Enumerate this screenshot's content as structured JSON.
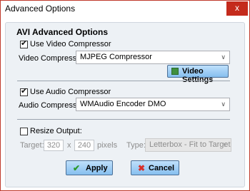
{
  "window": {
    "title": "Advanced Options",
    "close_label": "x"
  },
  "panel": {
    "header": "AVI Advanced Options",
    "video": {
      "checkbox_label": "Use Video Compressor",
      "checked": true,
      "compressor_label": "Video Compressor:",
      "compressor_value": "MJPEG Compressor",
      "settings_button": "Video Settings"
    },
    "audio": {
      "checkbox_label": "Use Audio Compressor",
      "checked": true,
      "compressor_label": "Audio Compressor:",
      "compressor_value": "WMAudio Encoder DMO"
    },
    "resize": {
      "checkbox_label": "Resize Output:",
      "checked": false,
      "target_label": "Target:",
      "width": "320",
      "x_label": "x",
      "height": "240",
      "pixels_label": "pixels",
      "type_label": "Type:",
      "type_value": "Letterbox - Fit to Target"
    }
  },
  "buttons": {
    "apply": "Apply",
    "cancel": "Cancel"
  },
  "icons": {
    "apply": "checkmark-icon",
    "cancel": "x-icon",
    "video_settings": "settings-icon"
  },
  "colors": {
    "close_button": "#c42b1c",
    "button_fill": "#9ccbf3",
    "apply_icon": "#2c9a2c",
    "cancel_icon": "#d8302a"
  }
}
